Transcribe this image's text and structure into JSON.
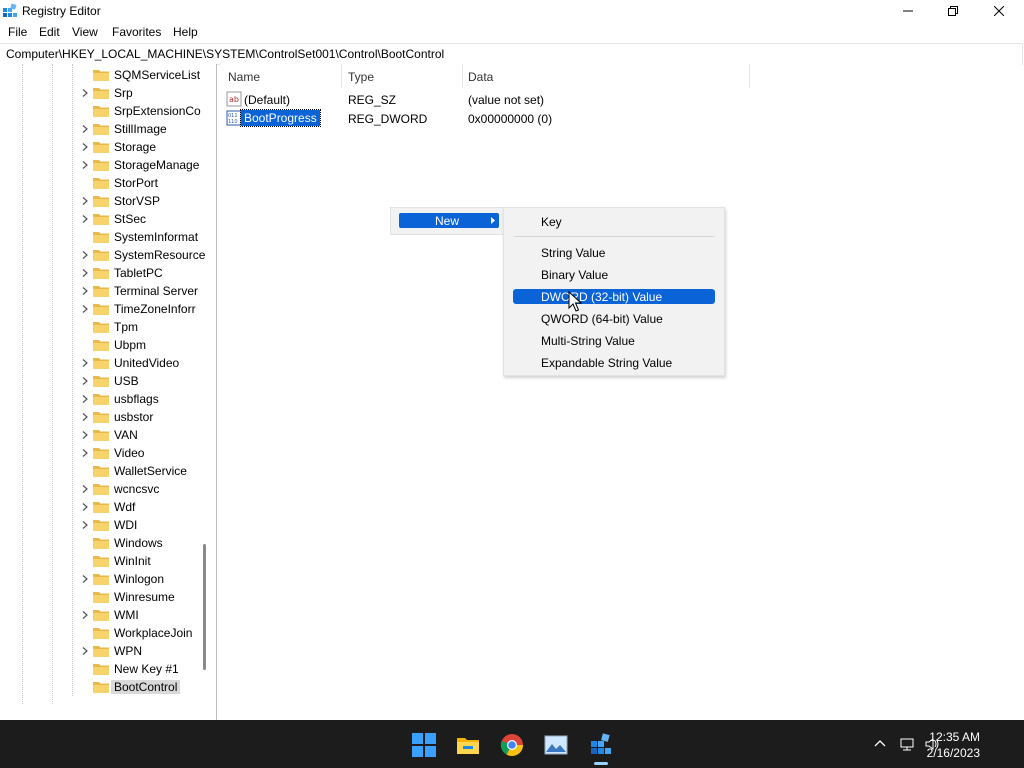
{
  "window": {
    "title": "Registry Editor",
    "controls": {
      "minimize": "minimize",
      "maximize": "restore",
      "close": "close"
    }
  },
  "menu": [
    "File",
    "Edit",
    "View",
    "Favorites",
    "Help"
  ],
  "address": "Computer\\HKEY_LOCAL_MACHINE\\SYSTEM\\ControlSet001\\Control\\BootControl",
  "tree": {
    "items": [
      {
        "label": "SQMServiceList",
        "expandable": false
      },
      {
        "label": "Srp",
        "expandable": true
      },
      {
        "label": "SrpExtensionCo",
        "expandable": false
      },
      {
        "label": "StillImage",
        "expandable": true
      },
      {
        "label": "Storage",
        "expandable": true
      },
      {
        "label": "StorageManage",
        "expandable": true
      },
      {
        "label": "StorPort",
        "expandable": false
      },
      {
        "label": "StorVSP",
        "expandable": true
      },
      {
        "label": "StSec",
        "expandable": true
      },
      {
        "label": "SystemInformat",
        "expandable": false
      },
      {
        "label": "SystemResource",
        "expandable": true
      },
      {
        "label": "TabletPC",
        "expandable": true
      },
      {
        "label": "Terminal Server",
        "expandable": true
      },
      {
        "label": "TimeZoneInforr",
        "expandable": true
      },
      {
        "label": "Tpm",
        "expandable": false
      },
      {
        "label": "Ubpm",
        "expandable": false
      },
      {
        "label": "UnitedVideo",
        "expandable": true
      },
      {
        "label": "USB",
        "expandable": true
      },
      {
        "label": "usbflags",
        "expandable": true
      },
      {
        "label": "usbstor",
        "expandable": true
      },
      {
        "label": "VAN",
        "expandable": true
      },
      {
        "label": "Video",
        "expandable": true
      },
      {
        "label": "WalletService",
        "expandable": false
      },
      {
        "label": "wcncsvc",
        "expandable": true
      },
      {
        "label": "Wdf",
        "expandable": true
      },
      {
        "label": "WDI",
        "expandable": true
      },
      {
        "label": "Windows",
        "expandable": false
      },
      {
        "label": "WinInit",
        "expandable": false
      },
      {
        "label": "Winlogon",
        "expandable": true
      },
      {
        "label": "Winresume",
        "expandable": false
      },
      {
        "label": "WMI",
        "expandable": true
      },
      {
        "label": "WorkplaceJoin",
        "expandable": false
      },
      {
        "label": "WPN",
        "expandable": true
      },
      {
        "label": "New Key #1",
        "expandable": false
      },
      {
        "label": "BootControl",
        "expandable": false,
        "selected": true
      }
    ]
  },
  "list": {
    "columns": [
      "Name",
      "Type",
      "Data"
    ],
    "rows": [
      {
        "name": "(Default)",
        "type": "REG_SZ",
        "data": "(value not set)",
        "icon": "string-value-icon"
      },
      {
        "name": "BootProgress",
        "type": "REG_DWORD",
        "data": "0x00000000 (0)",
        "icon": "binary-value-icon",
        "selected": true
      }
    ]
  },
  "context_menu": {
    "new_label": "New",
    "submenu": [
      {
        "label": "Key"
      },
      {
        "label": "String Value"
      },
      {
        "label": "Binary Value"
      },
      {
        "label": "DWORD (32-bit) Value",
        "highlighted": true
      },
      {
        "label": "QWORD (64-bit) Value"
      },
      {
        "label": "Multi-String Value"
      },
      {
        "label": "Expandable String Value"
      }
    ]
  },
  "taskbar": {
    "apps": [
      "start-icon",
      "file-explorer-icon",
      "chrome-icon",
      "photos-icon",
      "registry-editor-icon"
    ],
    "time": "12:35 AM",
    "date": "2/16/2023"
  },
  "colors": {
    "selection": "#0a64d8",
    "taskbar": "#1c1c1c",
    "folder": "#f2c94c"
  }
}
